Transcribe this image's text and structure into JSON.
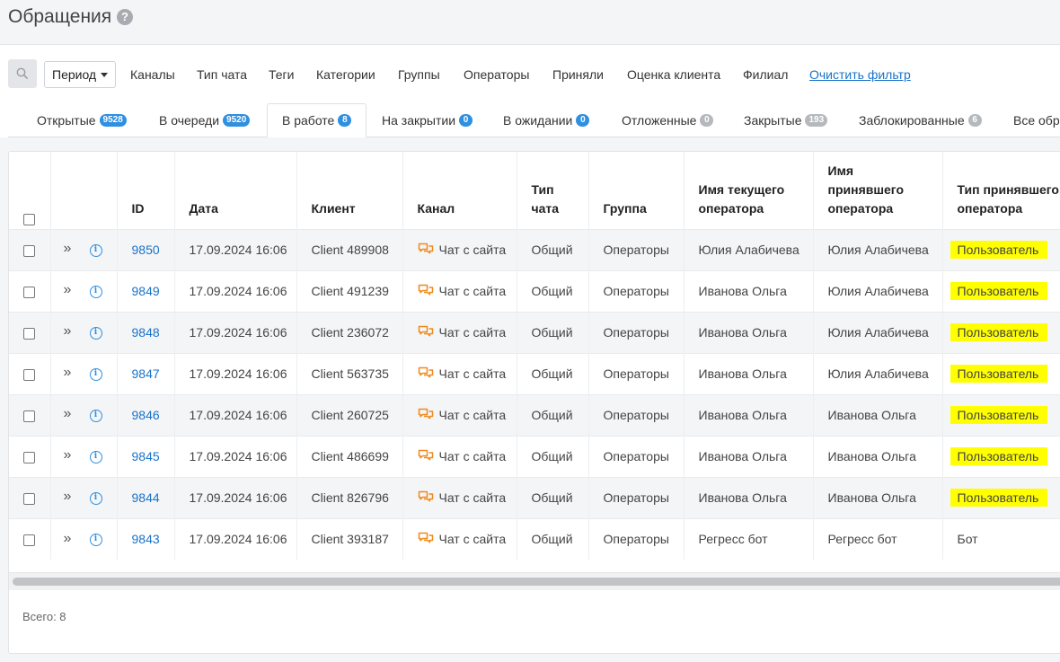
{
  "header": {
    "title": "Обращения",
    "help": "?"
  },
  "filters": {
    "period": "Период",
    "items": [
      "Каналы",
      "Тип чата",
      "Теги",
      "Категории",
      "Группы",
      "Операторы",
      "Приняли",
      "Оценка клиента",
      "Филиал"
    ],
    "clear": "Очистить фильтр"
  },
  "tabs": [
    {
      "label": "Открытые",
      "count": "9528",
      "color": "blue"
    },
    {
      "label": "В очереди",
      "count": "9520",
      "color": "blue"
    },
    {
      "label": "В работе",
      "count": "8",
      "color": "blue"
    },
    {
      "label": "На закрытии",
      "count": "0",
      "color": "blue"
    },
    {
      "label": "В ожидании",
      "count": "0",
      "color": "blue"
    },
    {
      "label": "Отложенные",
      "count": "0",
      "color": "gray"
    },
    {
      "label": "Закрытые",
      "count": "193",
      "color": "gray"
    },
    {
      "label": "Заблокированные",
      "count": "6",
      "color": "gray"
    },
    {
      "label": "Все обра",
      "count": "",
      "color": "gray"
    }
  ],
  "table": {
    "headers": {
      "id": "ID",
      "date": "Дата",
      "client": "Клиент",
      "channel": "Канал",
      "chat_type": "Тип чата",
      "group": "Группа",
      "current_operator": "Имя текущего оператора",
      "accepted_operator": "Имя принявшего оператора",
      "accepted_type": "Тип принявшего оператора"
    },
    "rows": [
      {
        "id": "9850",
        "date": "17.09.2024 16:06",
        "client": "Client 489908",
        "channel": "Чат с сайта",
        "chat_type": "Общий",
        "group": "Операторы",
        "current_operator": "Юлия Алабичева",
        "accepted_operator": "Юлия Алабичева",
        "accepted_type": "Пользователь",
        "highlight": true
      },
      {
        "id": "9849",
        "date": "17.09.2024 16:06",
        "client": "Client 491239",
        "channel": "Чат с сайта",
        "chat_type": "Общий",
        "group": "Операторы",
        "current_operator": "Иванова Ольга",
        "accepted_operator": "Юлия Алабичева",
        "accepted_type": "Пользователь",
        "highlight": true
      },
      {
        "id": "9848",
        "date": "17.09.2024 16:06",
        "client": "Client 236072",
        "channel": "Чат с сайта",
        "chat_type": "Общий",
        "group": "Операторы",
        "current_operator": "Иванова Ольга",
        "accepted_operator": "Юлия Алабичева",
        "accepted_type": "Пользователь",
        "highlight": true
      },
      {
        "id": "9847",
        "date": "17.09.2024 16:06",
        "client": "Client 563735",
        "channel": "Чат с сайта",
        "chat_type": "Общий",
        "group": "Операторы",
        "current_operator": "Иванова Ольга",
        "accepted_operator": "Юлия Алабичева",
        "accepted_type": "Пользователь",
        "highlight": true
      },
      {
        "id": "9846",
        "date": "17.09.2024 16:06",
        "client": "Client 260725",
        "channel": "Чат с сайта",
        "chat_type": "Общий",
        "group": "Операторы",
        "current_operator": "Иванова Ольга",
        "accepted_operator": "Иванова Ольга",
        "accepted_type": "Пользователь",
        "highlight": true
      },
      {
        "id": "9845",
        "date": "17.09.2024 16:06",
        "client": "Client 486699",
        "channel": "Чат с сайта",
        "chat_type": "Общий",
        "group": "Операторы",
        "current_operator": "Иванова Ольга",
        "accepted_operator": "Иванова Ольга",
        "accepted_type": "Пользователь",
        "highlight": true
      },
      {
        "id": "9844",
        "date": "17.09.2024 16:06",
        "client": "Client 826796",
        "channel": "Чат с сайта",
        "chat_type": "Общий",
        "group": "Операторы",
        "current_operator": "Иванова Ольга",
        "accepted_operator": "Иванова Ольга",
        "accepted_type": "Пользователь",
        "highlight": true
      },
      {
        "id": "9843",
        "date": "17.09.2024 16:06",
        "client": "Client 393187",
        "channel": "Чат с сайта",
        "chat_type": "Общий",
        "group": "Операторы",
        "current_operator": "Регресс бот",
        "accepted_operator": "Регресс бот",
        "accepted_type": "Бот",
        "highlight": false
      }
    ]
  },
  "footer": {
    "total": "Всего: 8"
  },
  "colors": {
    "accent": "#2f8fe0",
    "link": "#1a73c9",
    "highlight": "#ffff00",
    "channel_icon": "#f08a1c"
  }
}
